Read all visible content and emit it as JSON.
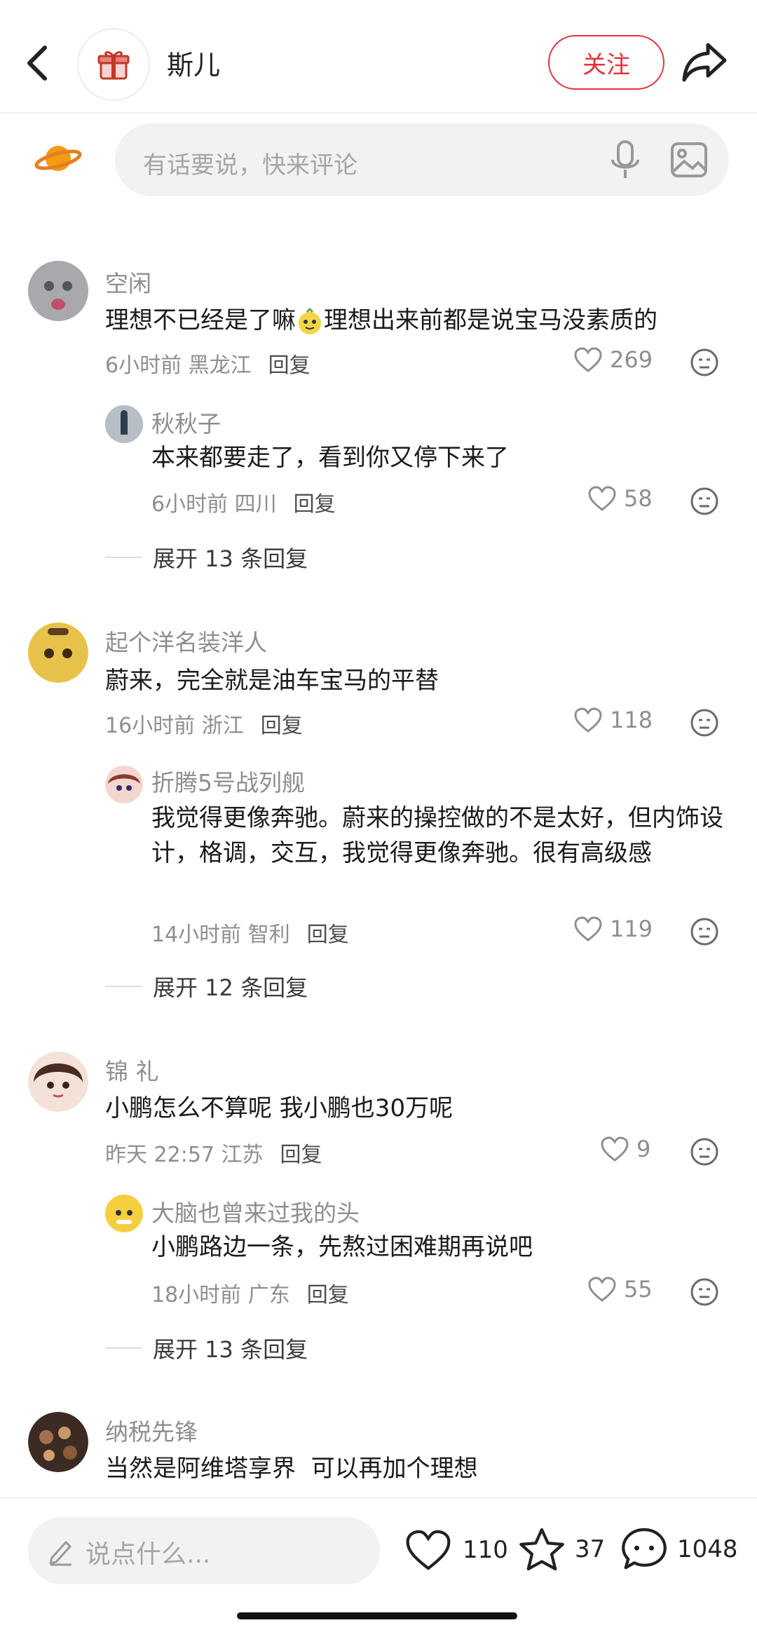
{
  "header": {
    "title": "斯儿",
    "follow_label": "关注"
  },
  "comment_box": {
    "placeholder": "有话要说，快来评论"
  },
  "comments": [
    {
      "user": "空闲",
      "text_a": "理想不已经是了嘛",
      "text_b": "理想出来前都是说宝马没素质的",
      "time": "6小时前",
      "location": "黑龙江",
      "reply": "回复",
      "likes": "269",
      "sub": {
        "user": "秋秋子",
        "text": "本来都要走了，看到你又停下来了",
        "time": "6小时前",
        "location": "四川",
        "reply": "回复",
        "likes": "58"
      },
      "expand": "展开 13 条回复"
    },
    {
      "user": "起个洋名装洋人",
      "text": "蔚来，完全就是油车宝马的平替",
      "time": "16小时前",
      "location": "浙江",
      "reply": "回复",
      "likes": "118",
      "sub": {
        "user": "折腾5号战列舰",
        "text": "我觉得更像奔驰。蔚来的操控做的不是太好，但内饰设计，格调，交互，我觉得更像奔驰。很有高级感",
        "time": "14小时前",
        "location": "智利",
        "reply": "回复",
        "likes": "119"
      },
      "expand": "展开 12 条回复"
    },
    {
      "user": "锦 礼",
      "text": "小鹏怎么不算呢 我小鹏也30万呢",
      "time": "昨天 22:57",
      "location": "江苏",
      "reply": "回复",
      "likes": "9",
      "sub": {
        "user": "大脑也曾来过我的头",
        "text": "小鹏路边一条，先熬过困难期再说吧",
        "time": "18小时前",
        "location": "广东",
        "reply": "回复",
        "likes": "55"
      },
      "expand": "展开 13 条回复"
    },
    {
      "user": "纳税先锋",
      "text": "当然是阿维塔享界  可以再加个理想"
    }
  ],
  "bottom_bar": {
    "placeholder": "说点什么...",
    "like_count": "110",
    "star_count": "37",
    "comment_count": "1048"
  },
  "colors": {
    "accent": "#e6323c",
    "muted": "#8e8e8e",
    "input_bg": "#f2f2f2"
  }
}
